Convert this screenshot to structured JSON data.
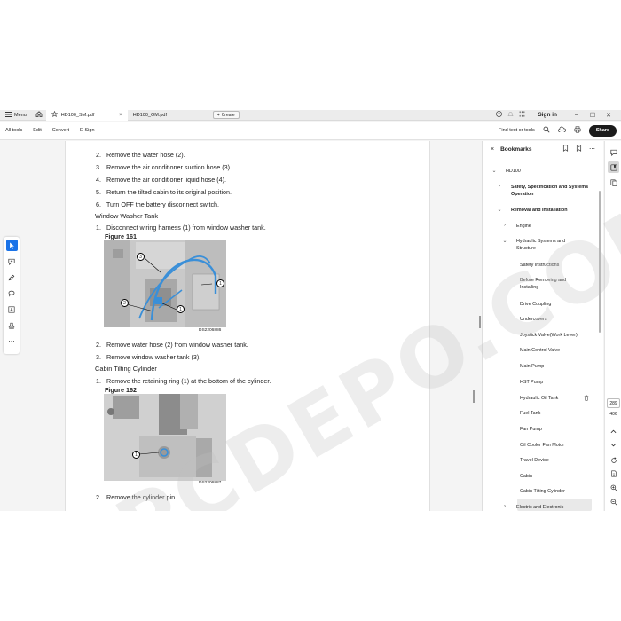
{
  "tabbar": {
    "menu_label": "Menu",
    "tabs": [
      {
        "label": "HD100_SM.pdf"
      },
      {
        "label": "HD100_OM.pdf"
      }
    ],
    "create_label": "Create",
    "signin_label": "Sign in"
  },
  "toolbar": {
    "items": [
      "All tools",
      "Edit",
      "Convert",
      "E-Sign"
    ],
    "find_placeholder": "Find text or tools",
    "share_label": "Share"
  },
  "document": {
    "lines_a": [
      {
        "num": "2.",
        "text": "Remove the water hose (2)."
      },
      {
        "num": "3.",
        "text": "Remove the air conditioner suction hose (3)."
      },
      {
        "num": "4.",
        "text": "Remove the air conditioner liquid hose (4)."
      },
      {
        "num": "5.",
        "text": "Return the tilted cabin to its original position."
      },
      {
        "num": "6.",
        "text": "Turn OFF the battery disconnect switch."
      }
    ],
    "section1_heading": "Window Washer Tank",
    "section1_step1": {
      "num": "1.",
      "text": "Disconnect wiring harness (1) from window washer tank."
    },
    "figure1_caption": "Figure 161",
    "figure1_code": "DS2206886",
    "lines_b": [
      {
        "num": "2.",
        "text": "Remove water hose (2) from window washer tank."
      },
      {
        "num": "3.",
        "text": "Remove window washer tank (3)."
      }
    ],
    "section2_heading": "Cabin Tilting Cylinder",
    "section2_step1": {
      "num": "1.",
      "text": "Remove the retaining ring (1) at the bottom of the cylinder."
    },
    "figure2_caption": "Figure 162",
    "figure2_code": "DS2206887",
    "last_line": {
      "num": "2.",
      "text": "Remove the cylinder pin."
    },
    "callouts": {
      "c1": "1",
      "c2": "2",
      "c3": "3"
    }
  },
  "bookmarks": {
    "title": "Bookmarks",
    "items": [
      {
        "label": "HD100"
      },
      {
        "label": "Safety, Specification and Systems Operation"
      },
      {
        "label": "Removal and Installation"
      },
      {
        "label": "Engine"
      },
      {
        "label": "Hydraulic Systems and Structure"
      },
      {
        "label": "Safety Instructions"
      },
      {
        "label": "Before Removing and Installing"
      },
      {
        "label": "Drive Coupling"
      },
      {
        "label": "Undercovers"
      },
      {
        "label": "Joystick Valve(Work Lever)"
      },
      {
        "label": "Main Control Valve"
      },
      {
        "label": "Main Pump"
      },
      {
        "label": "HST Pump"
      },
      {
        "label": "Hydraulic Oil Tank"
      },
      {
        "label": "Fuel Tank"
      },
      {
        "label": "Fan Pump"
      },
      {
        "label": "Oil Cooler Fan Motor"
      },
      {
        "label": "Travel Device"
      },
      {
        "label": "Cabin"
      },
      {
        "label": "Cabin Tilting Cylinder"
      },
      {
        "label": "Electric and Electronic"
      }
    ]
  },
  "pager": {
    "current": "289",
    "total": "406"
  },
  "watermark": "EPCDEPO.COM",
  "colors": {
    "accent": "#1a73e8",
    "hose": "#3a8fd8"
  }
}
